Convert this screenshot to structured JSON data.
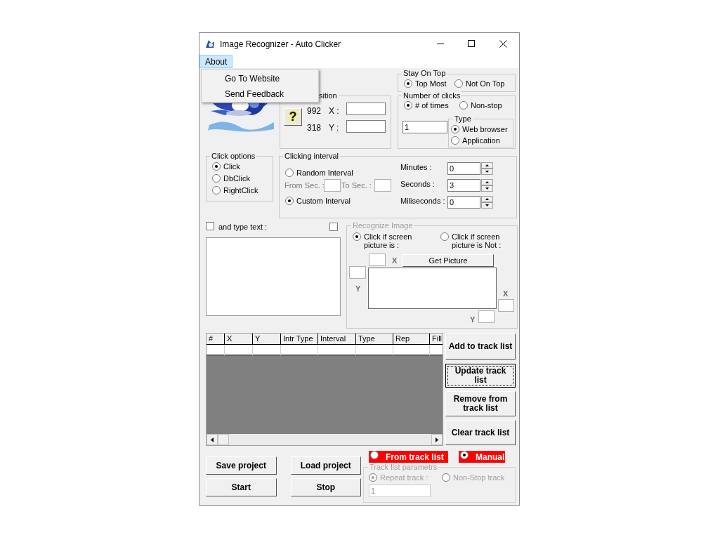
{
  "window": {
    "title": "Image Recognizer - Auto Clicker"
  },
  "menu": [
    {
      "label": "About",
      "selected": true
    }
  ],
  "menu_popup": {
    "items": [
      "Go To Website",
      "Send Feedback"
    ]
  },
  "cursor_position": {
    "title": "sition",
    "help_button": "?",
    "x_reading": "992",
    "x_label": "X :",
    "y_reading": "318",
    "y_label": "Y :"
  },
  "stay_on_top": {
    "title": "Stay On Top",
    "options": [
      {
        "label": "Top Most",
        "selected": true
      },
      {
        "label": "Not On Top",
        "selected": false
      }
    ]
  },
  "number_of_clicks": {
    "title": "Number of clicks",
    "options": [
      {
        "label": "# of times",
        "selected": true
      },
      {
        "label": "Non-stop",
        "selected": false
      }
    ],
    "count": "1",
    "type": {
      "title": "Type",
      "options": [
        {
          "label": "Web browser",
          "selected": true
        },
        {
          "label": "Application",
          "selected": false
        }
      ]
    }
  },
  "click_options": {
    "title": "Click options",
    "options": [
      {
        "label": "Click",
        "selected": true
      },
      {
        "label": "DbClick",
        "selected": false
      },
      {
        "label": "RightClick",
        "selected": false
      }
    ]
  },
  "clicking_interval": {
    "title": "Clicking interval",
    "random": {
      "label": "Random Interval",
      "selected": false
    },
    "from_label": "From Sec. :",
    "to_label": "To Sec. :",
    "custom": {
      "label": "Custom Interval",
      "selected": true
    },
    "fields": [
      {
        "label": "Minutes :",
        "value": "0"
      },
      {
        "label": "Seconds :",
        "value": "3"
      },
      {
        "label": "Miliseconds :",
        "value": "0"
      }
    ]
  },
  "type_text": {
    "label": "and type text :",
    "checked": false
  },
  "second_checkbox": {
    "checked": false
  },
  "recognize_image": {
    "title": "Recognize Image",
    "options": [
      {
        "label": "Click if screen picture is :",
        "selected": true
      },
      {
        "label": "Click if screen picture is Not :",
        "selected": false
      }
    ],
    "button": "Get Picture",
    "labels": [
      "X",
      "Y",
      "X",
      "Y"
    ]
  },
  "track_list": {
    "columns": [
      "#",
      "X",
      "Y",
      "Intr Type",
      "Interval",
      "Type",
      "Rep",
      "Fill"
    ]
  },
  "side_buttons": [
    {
      "label": "Add to track list",
      "focused": false
    },
    {
      "label": "Update track list",
      "focused": true
    },
    {
      "label": "Remove from track list",
      "focused": false
    },
    {
      "label": "Clear track list",
      "focused": false
    }
  ],
  "bottom_buttons": [
    "Save project",
    "Load project",
    "Start",
    "Stop"
  ],
  "mode": [
    {
      "label": "From track list",
      "selected": false
    },
    {
      "label": "Manual",
      "selected": true
    }
  ],
  "track_list_params": {
    "title": "Track list parametrs",
    "disabled": true,
    "options": [
      {
        "label": "Repeat track :",
        "selected": true
      },
      {
        "label": "Non-Stop track",
        "selected": false
      }
    ],
    "repeat_count": "1"
  }
}
